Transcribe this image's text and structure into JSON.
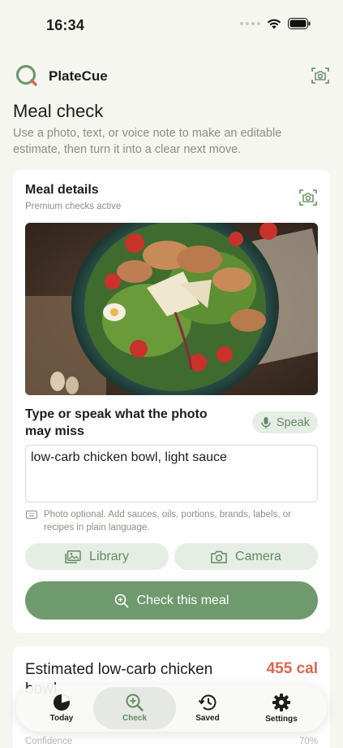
{
  "status": {
    "time": "16:34"
  },
  "app": {
    "name": "PlateCue"
  },
  "page": {
    "title": "Meal check",
    "subtitle": "Use a photo, text, or voice note to make an editable estimate, then turn it into a clear next move."
  },
  "meal_card": {
    "title": "Meal details",
    "subtitle": "Premium checks active",
    "speak_prompt": "Type or speak what the photo may miss",
    "speak_label": "Speak",
    "note_value": "low-carb chicken bowl, light sauce",
    "hint": "Photo optional. Add sauces, oils, portions, brands, labels, or recipes in plain language.",
    "library_label": "Library",
    "camera_label": "Camera",
    "check_label": "Check this meal"
  },
  "result": {
    "title": "Estimated low-carb chicken bowl",
    "calories": "455 cal",
    "confidence_label": "Confidence",
    "confidence_value": "70%"
  },
  "tabs": [
    {
      "label": "Today",
      "icon": "pie-chart-icon"
    },
    {
      "label": "Check",
      "icon": "magnifier-plus-icon"
    },
    {
      "label": "Saved",
      "icon": "history-icon"
    },
    {
      "label": "Settings",
      "icon": "gear-icon"
    }
  ],
  "colors": {
    "accent": "#6e9a6e",
    "calorie": "#d9674f",
    "background": "#f6f6f1"
  }
}
